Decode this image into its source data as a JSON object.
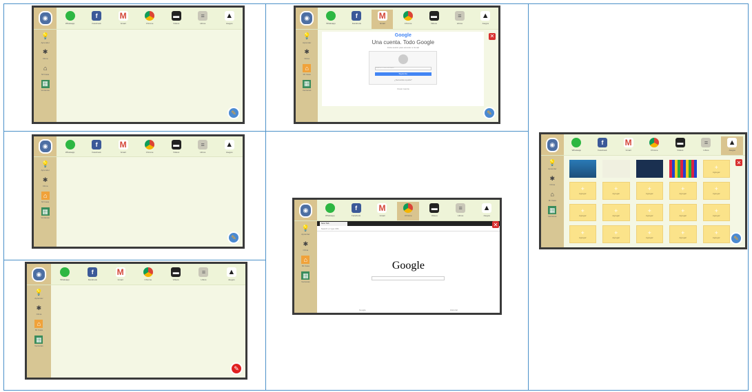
{
  "apps": [
    {
      "icon": "whatsapp-icon",
      "glyph": "",
      "label": "Whatsapp"
    },
    {
      "icon": "facebook-icon",
      "glyph": "f",
      "label": "Facebook"
    },
    {
      "icon": "gmail-icon",
      "glyph": "M",
      "label": "Gmail"
    },
    {
      "icon": "chrome-icon",
      "glyph": "",
      "label": "Chrome"
    },
    {
      "icon": "videos-icon",
      "glyph": "▬",
      "label": "Videos"
    },
    {
      "icon": "books-icon",
      "glyph": "≡",
      "label": "Libros"
    },
    {
      "icon": "gamepad-icon",
      "glyph": "▲",
      "label": "Juegos"
    }
  ],
  "sidebar": [
    {
      "icon": "lightbulb-icon",
      "glyph": "💡",
      "label": "Aprender"
    },
    {
      "icon": "fan-icon",
      "glyph": "✱",
      "label": "Clima"
    },
    {
      "icon": "house-icon",
      "glyph": "⌂",
      "label": "Mi Casa"
    },
    {
      "icon": "window-icon",
      "glyph": "▦",
      "label": "Ventanas"
    }
  ],
  "login": {
    "logo": "Google",
    "title": "Una cuenta. Todo Google",
    "subtitle": "Inicia sesión para acceder a Gmail",
    "email_placeholder": "Introduce tu correo electrónico",
    "button": "Siguiente",
    "help": "¿Necesitas ayuda?",
    "create": "Crear cuenta"
  },
  "browser": {
    "tab": "New Tab",
    "url_placeholder": "Search or type URL",
    "logo": "Google",
    "foot_left": "Google",
    "foot_right": "Historial"
  },
  "games": {
    "slots": [
      "",
      "",
      "",
      "",
      "Agregar",
      "Agregar",
      "Agregar",
      "Agregar",
      "Agregar",
      "Agregar",
      "Agregar",
      "Agregar",
      "Agregar",
      "Agregar",
      "Agregar",
      "Agregar",
      "Agregar",
      "Agregar",
      "Agregar",
      "Agregar"
    ]
  },
  "close_glyph": "✕",
  "corner_glyph": "✎",
  "plus_glyph": "+",
  "colors": {
    "topbar": "#eef4d8",
    "sidebar": "#d7c694",
    "screen": "#f4f7e4",
    "accent": "#4b8ad1",
    "close": "#d83030"
  }
}
